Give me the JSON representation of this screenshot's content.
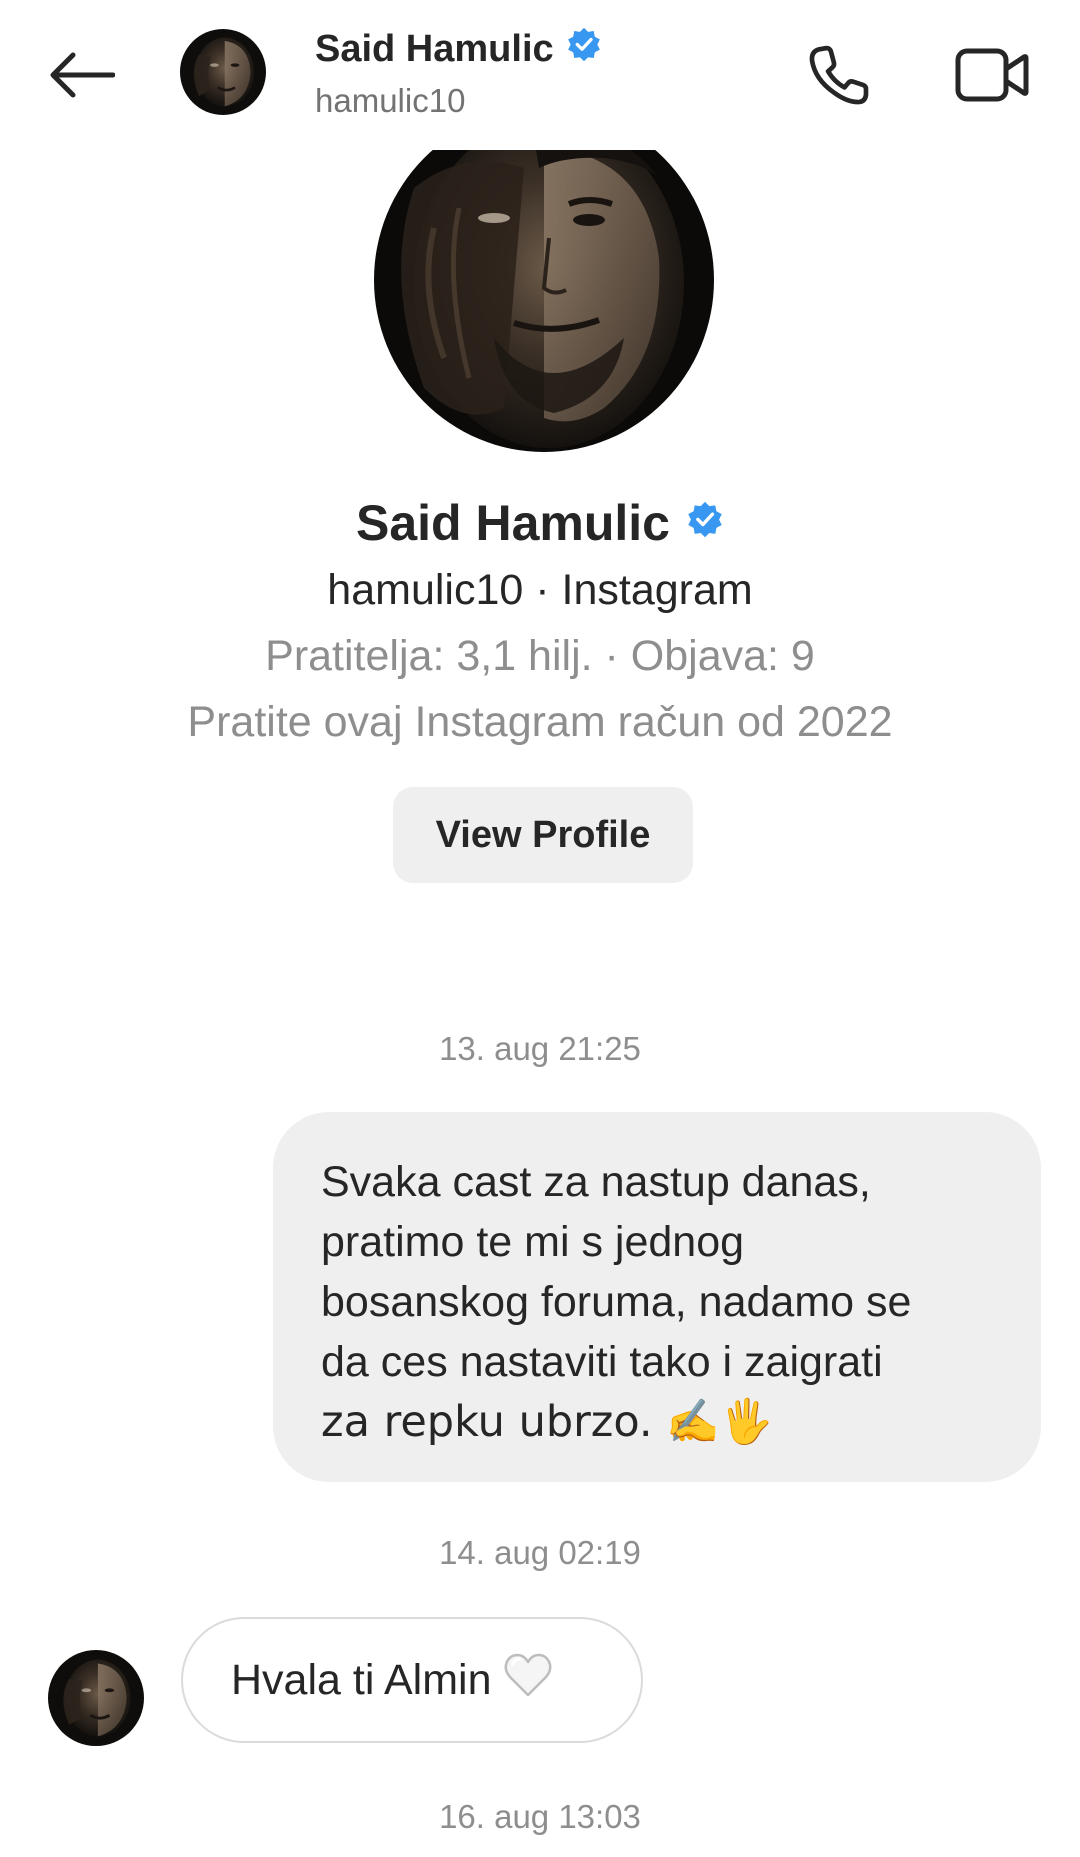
{
  "header": {
    "name": "Said Hamulic",
    "handle": "hamulic10",
    "icons": {
      "back": "arrow-left-icon",
      "verified": "verified-badge-icon",
      "call": "phone-icon",
      "video": "video-camera-icon"
    }
  },
  "profile": {
    "name": "Said Hamulic",
    "handle_line": "hamulic10 · Instagram",
    "stats": "Pratitelja: 3,1 hilj. · Objava: 9",
    "follow_since": "Pratite ovaj Instagram račun od 2022",
    "view_profile_label": "View Profile"
  },
  "messages": [
    {
      "timestamp": "13. aug 21:25",
      "direction": "outgoing",
      "lines": [
        "Svaka cast za nastup danas,",
        "pratimo te mi s jednog",
        "bosanskog foruma, nadamo se",
        "da ces nastaviti tako i zaigrati",
        "za repku ubrzo. ✍️🖐️"
      ]
    },
    {
      "timestamp": "14. aug 02:19",
      "direction": "incoming",
      "text": "Hvala ti Almin",
      "emoji_icon": "white-heart-icon"
    },
    {
      "timestamp": "16. aug 13:03"
    }
  ],
  "colors": {
    "verified_blue": "#3897f0",
    "bubble_gray": "#efefef",
    "secondary_text": "#8e8e8e",
    "primary_text": "#262626"
  }
}
